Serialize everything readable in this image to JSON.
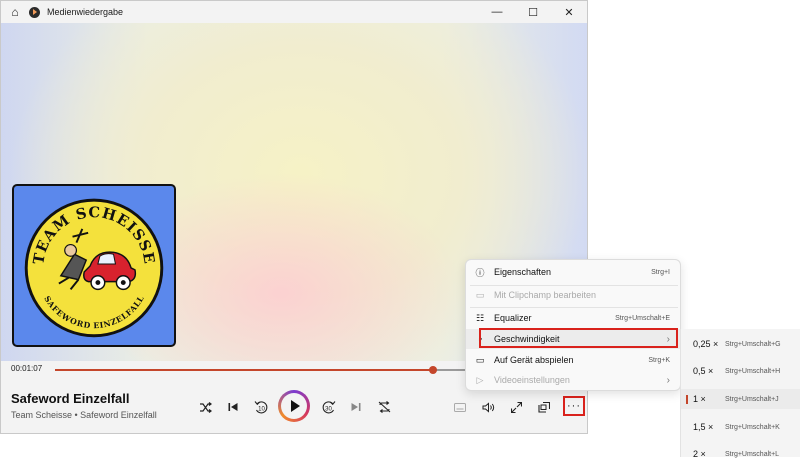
{
  "window": {
    "title": "Medienwiedergabe",
    "minimize": "—",
    "maximize": "☐",
    "close": "✕",
    "home": "⌂"
  },
  "player": {
    "current_time": "00:01:07",
    "progress_fraction": 0.713,
    "song_title": "Safeword Einzelfall",
    "song_subtitle": "Team Scheisse • Safeword Einzelfall",
    "skip_back_label": "10",
    "skip_forward_label": "30",
    "more_label": "···"
  },
  "album_art": {
    "top_text": "TEAM SCHEISSE",
    "bottom_text": "SAFEWORD EINZELFALL"
  },
  "menu": {
    "items": [
      {
        "label": "Eigenschaften",
        "shortcut": "Strg+I"
      },
      {
        "label": "Mit Clipchamp bearbeiten",
        "shortcut": ""
      },
      {
        "label": "Equalizer",
        "shortcut": "Strg+Umschalt+E"
      },
      {
        "label": "Geschwindigkeit",
        "shortcut": ""
      },
      {
        "label": "Auf Gerät abspielen",
        "shortcut": "Strg+K"
      },
      {
        "label": "Videoeinstellungen",
        "shortcut": ""
      }
    ]
  },
  "speed_menu": {
    "items": [
      {
        "rate": "0,25 ×",
        "shortcut": "Strg+Umschalt+G"
      },
      {
        "rate": "0,5 ×",
        "shortcut": "Strg+Umschalt+H"
      },
      {
        "rate": "1 ×",
        "shortcut": "Strg+Umschalt+J"
      },
      {
        "rate": "1,5 ×",
        "shortcut": "Strg+Umschalt+K"
      },
      {
        "rate": "2 ×",
        "shortcut": "Strg+Umschalt+L"
      }
    ],
    "selected_index": 2
  },
  "colors": {
    "accent": "#c4462b",
    "highlight_box": "#d9221c",
    "album_background": "#5b88ec",
    "badge_yellow": "#f4e13c"
  }
}
